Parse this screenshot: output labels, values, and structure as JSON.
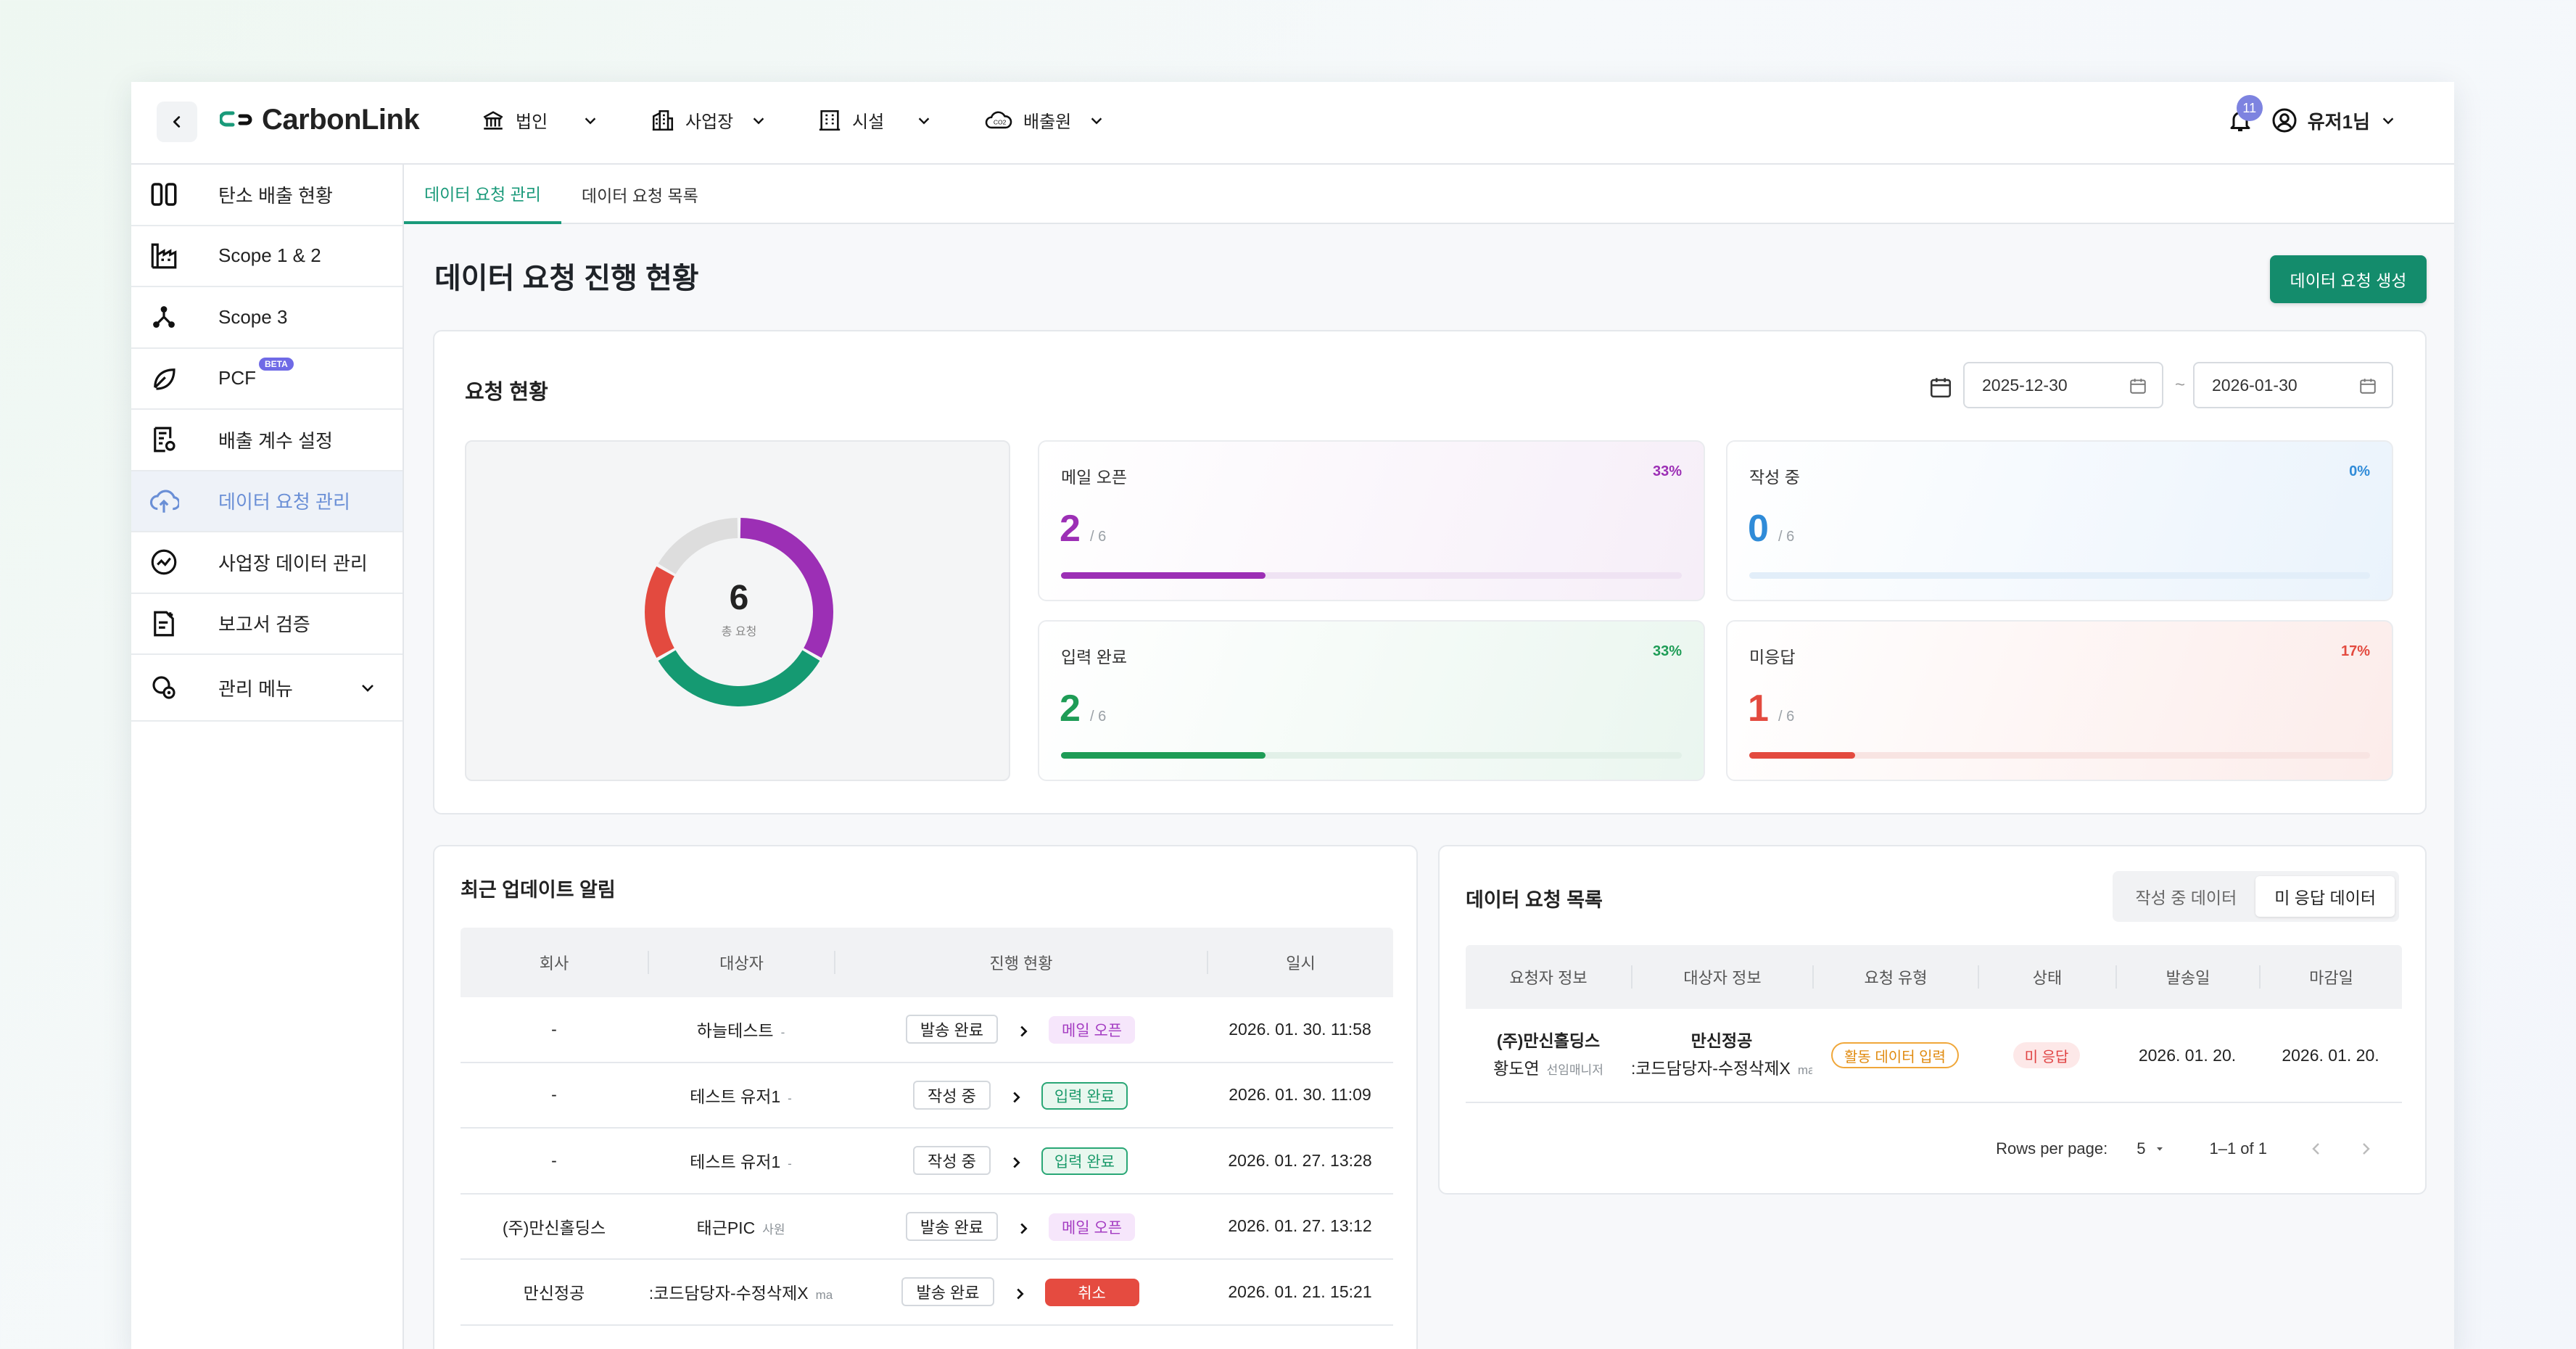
{
  "header": {
    "logo": "CarbonLink",
    "nav": [
      {
        "label": "법인",
        "icon": "bank-icon"
      },
      {
        "label": "사업장",
        "icon": "buildings-icon"
      },
      {
        "label": "시설",
        "icon": "building-icon"
      },
      {
        "label": "배출원",
        "icon": "cloud-co2-icon"
      }
    ],
    "notification_count": "11",
    "user_name": "유저1님"
  },
  "sidebar": {
    "items": [
      {
        "label": "탄소 배출 현황"
      },
      {
        "label": "Scope 1 & 2"
      },
      {
        "label": "Scope 3"
      },
      {
        "label": "PCF",
        "badge": "BETA"
      },
      {
        "label": "배출 계수 설정"
      },
      {
        "label": "데이터 요청 관리",
        "active": true
      },
      {
        "label": "사업장 데이터 관리"
      },
      {
        "label": "보고서 검증"
      },
      {
        "label": "관리 메뉴"
      }
    ]
  },
  "tabs": [
    "데이터 요청 관리",
    "데이터 요청 목록"
  ],
  "page": {
    "title": "데이터 요청 진행 현황",
    "create_button": "데이터 요청 생성"
  },
  "summary": {
    "title": "요청 현황",
    "date_from": "2025-12-30",
    "date_sep": "~",
    "date_to": "2026-01-30",
    "donut": {
      "total": "6",
      "total_label": "총 요청"
    },
    "stats": [
      {
        "label": "메일 오픈",
        "value": "2",
        "total": "/ 6",
        "pct": "33%",
        "ratio": 0.33,
        "color": "#9c2fb5",
        "track": "#efe3f3"
      },
      {
        "label": "작성 중",
        "value": "0",
        "total": "/ 6",
        "pct": "0%",
        "ratio": 0,
        "color": "#2f8bd8",
        "track": "#e2eef9"
      },
      {
        "label": "입력 완료",
        "value": "2",
        "total": "/ 6",
        "pct": "33%",
        "ratio": 0.33,
        "color": "#1e9c56",
        "track": "#e2f0e8"
      },
      {
        "label": "미응답",
        "value": "1",
        "total": "/ 6",
        "pct": "17%",
        "ratio": 0.17,
        "color": "#e34a3f",
        "track": "#f8e4e2"
      }
    ],
    "colors": {
      "mail_open": "#9c2fb5",
      "input_done": "#159a72",
      "no_reply": "#e34a3f",
      "remaining": "#dddddd"
    }
  },
  "updates": {
    "title": "최근 업데이트 알림",
    "columns": [
      "회사",
      "대상자",
      "진행 현황",
      "일시"
    ],
    "rows": [
      {
        "company": "-",
        "target": "하늘테스트",
        "target_sub": "-",
        "from": "발송 완료",
        "to": "메일 오픈",
        "to_type": "mail",
        "date": "2026. 01. 30. 11:58"
      },
      {
        "company": "-",
        "target": "테스트 유저1",
        "target_sub": "-",
        "from": "작성 중",
        "to": "입력 완료",
        "to_type": "done",
        "date": "2026. 01. 30. 11:09"
      },
      {
        "company": "-",
        "target": "테스트 유저1",
        "target_sub": "-",
        "from": "작성 중",
        "to": "입력 완료",
        "to_type": "done",
        "date": "2026. 01. 27. 13:28"
      },
      {
        "company": "(주)만신홀딩스",
        "target": "태근PIC",
        "target_sub": "사원",
        "from": "발송 완료",
        "to": "메일 오픈",
        "to_type": "mail",
        "date": "2026. 01. 27. 13:12"
      },
      {
        "company": "만신정공",
        "target": ":코드담당자-수정삭제X",
        "target_sub": "ma",
        "from": "발송 완료",
        "to": "취소",
        "to_type": "cancel",
        "date": "2026. 01. 21. 15:21"
      }
    ]
  },
  "requests": {
    "title": "데이터 요청 목록",
    "segments": [
      "작성 중 데이터",
      "미 응답 데이터"
    ],
    "columns": [
      "요청자 정보",
      "대상자 정보",
      "요청 유형",
      "상태",
      "발송일",
      "마감일"
    ],
    "rows": [
      {
        "req_company": "(주)만신홀딩스",
        "req_name": "황도연",
        "req_role": "선임매니저",
        "target_company": "만신정공",
        "target_name": ":코드담당자-수정삭제X",
        "target_sub": "ma",
        "type": "활동 데이터 입력",
        "status": "미 응답",
        "sent": "2026. 01. 20.",
        "due": "2026. 01. 20."
      }
    ],
    "rows_per_page_label": "Rows per page:",
    "rows_per_page": "5",
    "range": "1–1 of 1"
  }
}
